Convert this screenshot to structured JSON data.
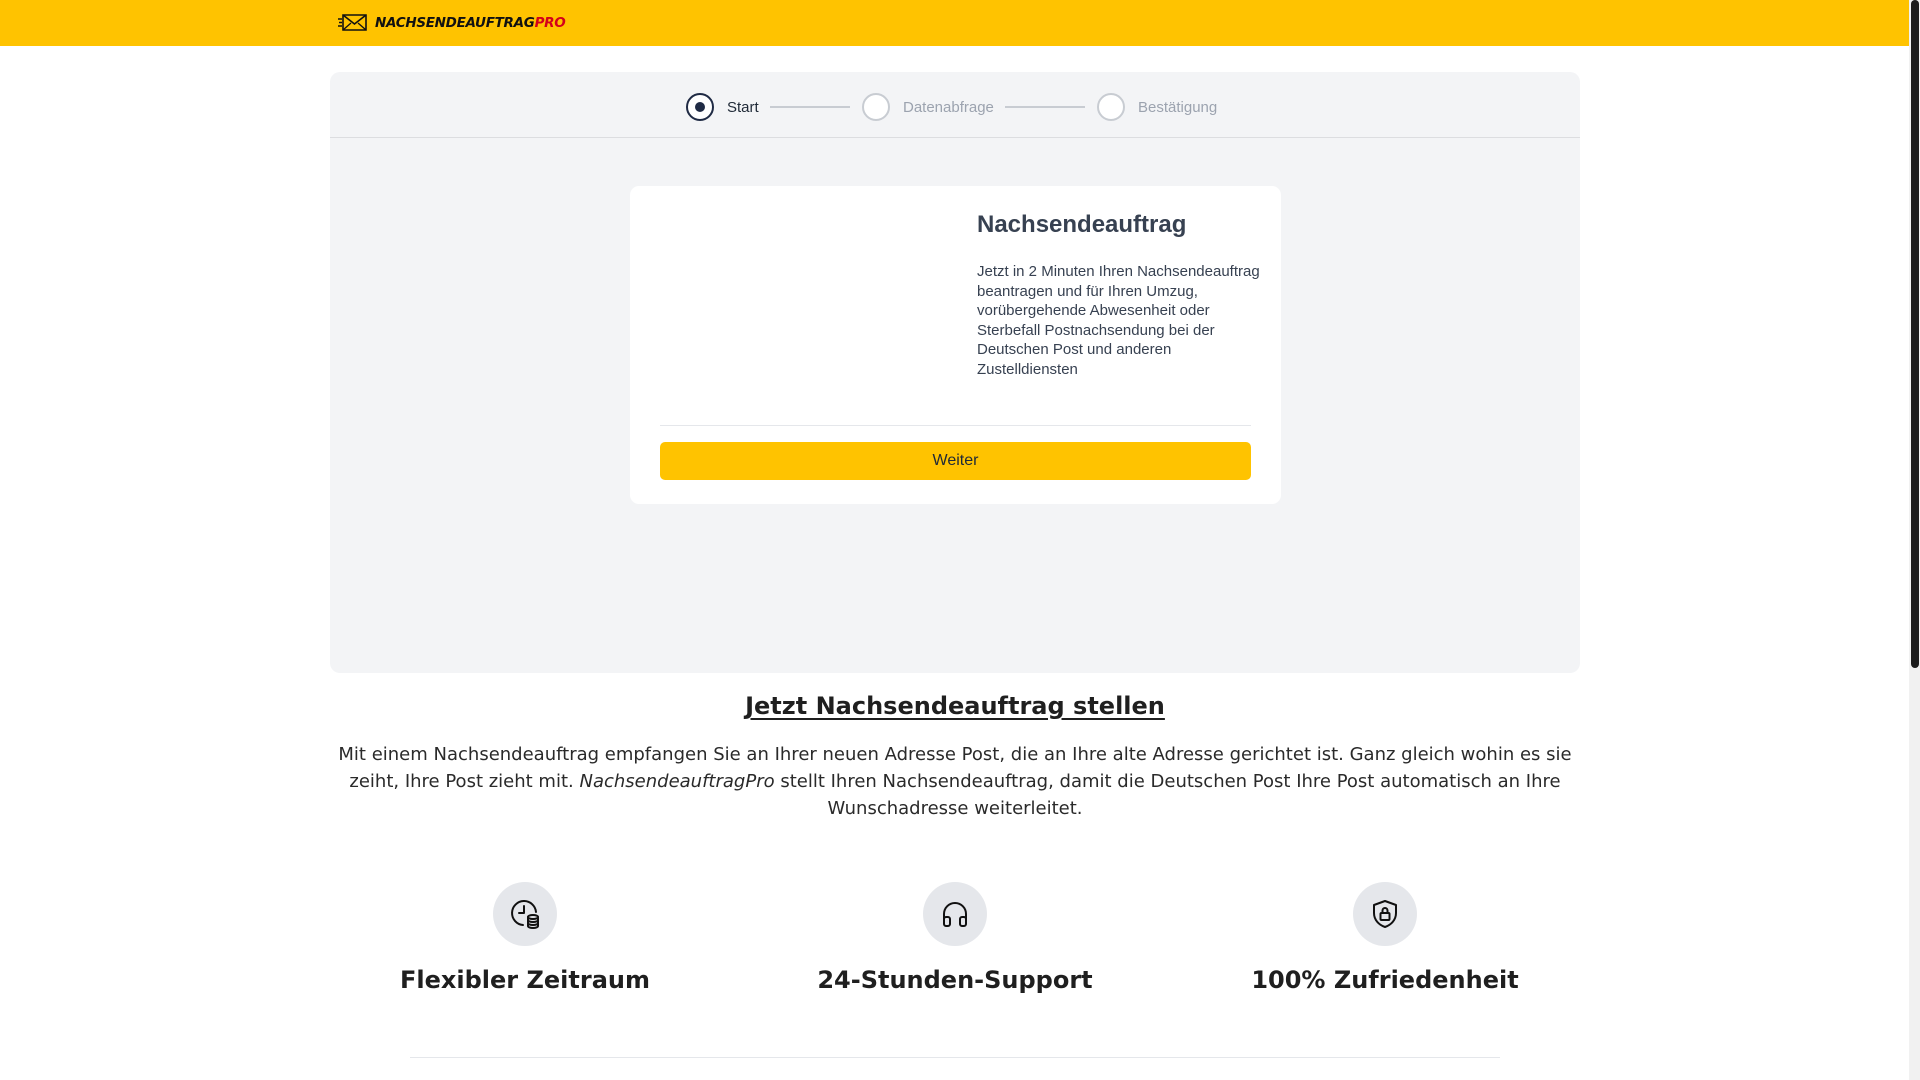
{
  "header": {
    "brand_main": "NACHSENDEAUFTRAG",
    "brand_accent": "PRO",
    "brand_color": "#ffc300",
    "accent_color": "#d4001a"
  },
  "stepper": {
    "steps": [
      {
        "label": "Start",
        "state": "active"
      },
      {
        "label": "Datenabfrage",
        "state": "inactive"
      },
      {
        "label": "Bestätigung",
        "state": "inactive"
      }
    ]
  },
  "card": {
    "title": "Nachsendeauftrag",
    "text": "Jetzt in 2 Minuten Ihren Nachsendeauftrag beantragen und für Ihren Umzug, vorübergehende Abwesenheit oder Sterbefall Postnachsendung bei der Deutschen Post und anderen Zustelldiensten",
    "button_label": "Weiter"
  },
  "section": {
    "title": "Jetzt Nachsendeauftrag stellen",
    "text_before": "Mit einem Nachsendeauftrag empfangen Sie an Ihrer neuen Adresse Post, die an Ihre alte Adresse gerichtet ist. Ganz gleich wohin es sie zeiht, Ihre Post zieht mit. ",
    "text_brand": "NachsendeauftragPro",
    "text_after": " stellt Ihren Nachsendeauftrag, damit die Deutschen Post Ihre Post automatisch an Ihre Wunschadresse weiterleitet."
  },
  "features": [
    {
      "icon": "calendar-clock-icon",
      "label": "Flexibler Zeitraum"
    },
    {
      "icon": "headphones-icon",
      "label": "24-Stunden-Support"
    },
    {
      "icon": "shield-lock-icon",
      "label": "100% Zufriedenheit"
    }
  ]
}
